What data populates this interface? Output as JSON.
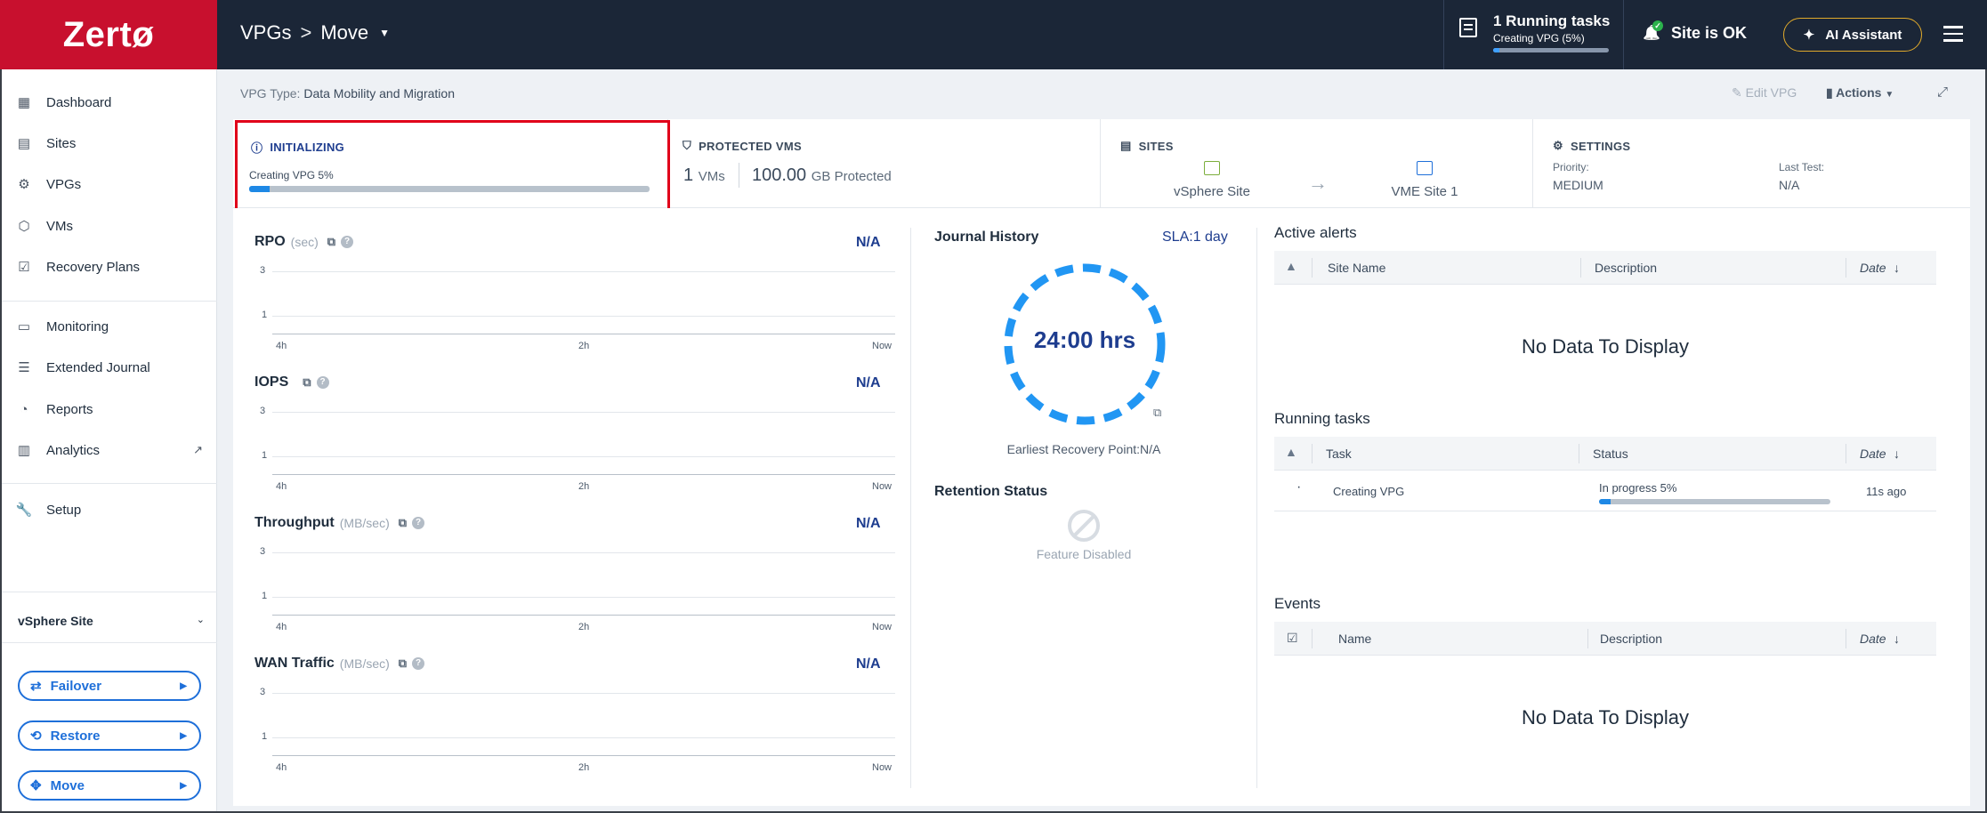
{
  "app": {
    "logo": "Zertø"
  },
  "breadcrumb": {
    "root": "VPGs",
    "separator": ">",
    "current": "Move"
  },
  "topbar": {
    "tasks_title": "1 Running tasks",
    "tasks_sub": "Creating VPG (5%)",
    "tasks_progress": 0.05,
    "site_status": "Site is OK",
    "ai_label": "AI Assistant"
  },
  "sidebar": {
    "items": [
      {
        "label": "Dashboard",
        "icon": "dashboard-icon"
      },
      {
        "label": "Sites",
        "icon": "sites-icon"
      },
      {
        "label": "VPGs",
        "icon": "vpgs-icon"
      },
      {
        "label": "VMs",
        "icon": "vms-icon"
      },
      {
        "label": "Recovery Plans",
        "icon": "recovery-plans-icon"
      },
      {
        "label": "Monitoring",
        "icon": "monitor-icon"
      },
      {
        "label": "Extended Journal",
        "icon": "database-icon"
      },
      {
        "label": "Reports",
        "icon": "reports-icon"
      },
      {
        "label": "Analytics",
        "icon": "analytics-icon"
      },
      {
        "label": "Setup",
        "icon": "wrench-icon"
      }
    ],
    "site_select": "vSphere Site",
    "actions": [
      "Failover",
      "Restore",
      "Move"
    ]
  },
  "header": {
    "vpg_type_label": "VPG Type:",
    "vpg_type_value": "Data Mobility and Migration",
    "edit_label": "Edit VPG",
    "actions_label": "Actions"
  },
  "summary": {
    "init_title": "INITIALIZING",
    "init_sub": "Creating VPG 5%",
    "init_progress": 0.05,
    "protected_title": "PROTECTED VMS",
    "vm_count": "1",
    "vm_unit": "VMs",
    "gb_value": "100.00",
    "gb_unit": "GB Protected",
    "sites_title": "SITES",
    "source_site": "vSphere Site",
    "target_site": "VME Site 1",
    "settings_title": "SETTINGS",
    "priority_label": "Priority:",
    "priority_value": "MEDIUM",
    "last_test_label": "Last Test:",
    "last_test_value": "N/A"
  },
  "metrics": [
    {
      "title": "RPO",
      "unit": "(sec)",
      "value": "N/A"
    },
    {
      "title": "IOPS",
      "unit": "",
      "value": "N/A"
    },
    {
      "title": "Throughput",
      "unit": "(MB/sec)",
      "value": "N/A"
    },
    {
      "title": "WAN Traffic",
      "unit": "(MB/sec)",
      "value": "N/A"
    }
  ],
  "metric_axis": {
    "y_top": "3",
    "y_mid": "1",
    "x_left": "4h",
    "x_mid": "2h",
    "x_right": "Now"
  },
  "journal": {
    "title": "Journal History",
    "sla": "SLA:1 day",
    "value": "24:00 hrs",
    "earliest": "Earliest Recovery Point:N/A",
    "retention_title": "Retention Status",
    "retention_state": "Feature Disabled"
  },
  "alerts": {
    "title": "Active alerts",
    "cols": [
      "Site Name",
      "Description",
      "Date"
    ],
    "empty": "No Data To Display"
  },
  "running_tasks": {
    "title": "Running tasks",
    "cols": [
      "Task",
      "Status",
      "Date"
    ],
    "row": {
      "bullet": "·",
      "task": "Creating VPG",
      "status": "In progress 5%",
      "progress": 0.05,
      "date": "11s ago"
    }
  },
  "events": {
    "title": "Events",
    "cols": [
      "Name",
      "Description",
      "Date"
    ],
    "empty": "No Data To Display"
  }
}
